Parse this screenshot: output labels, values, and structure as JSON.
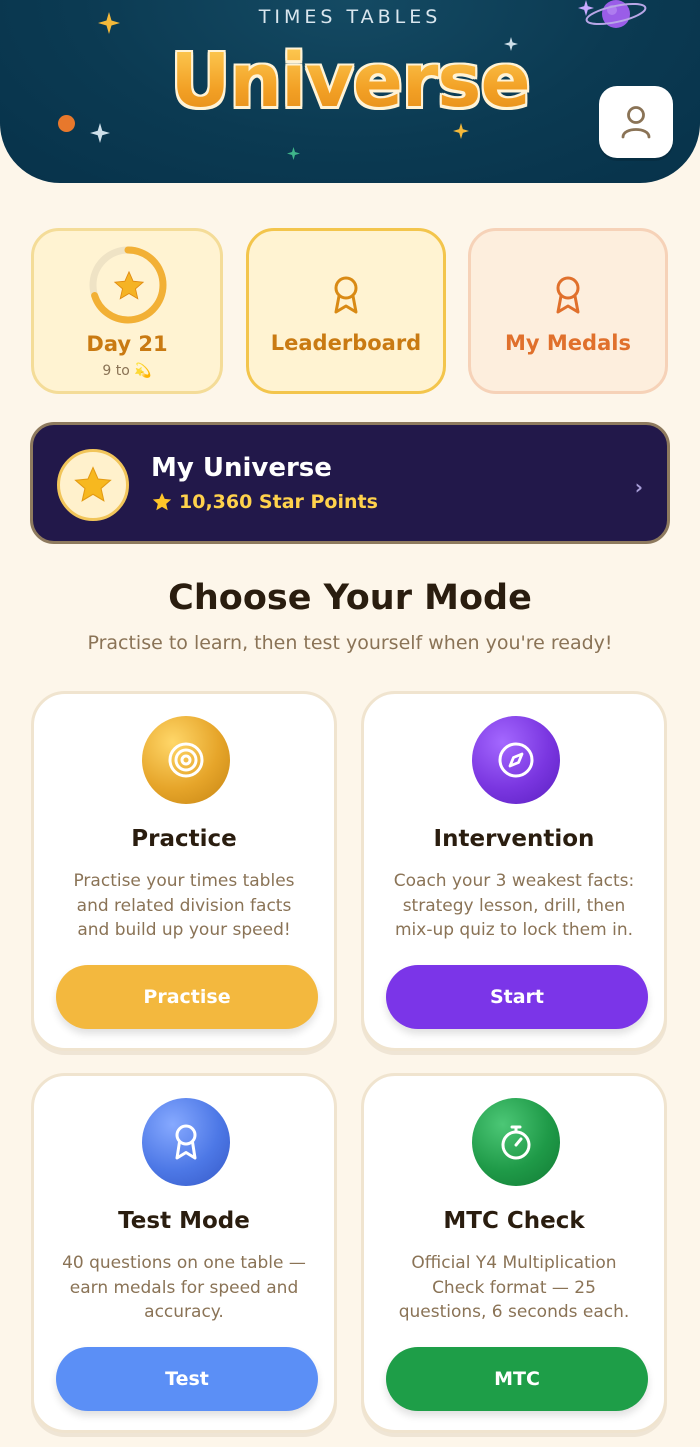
{
  "header": {
    "subtitle": "TIMES TABLES",
    "title": "Universe",
    "profile_icon": "user-icon"
  },
  "stats": {
    "day": {
      "label": "Day 21",
      "sub": "9 to 💫",
      "icon": "star-icon",
      "progress": 0.7
    },
    "leaderboard": {
      "label": "Leaderboard",
      "icon": "ribbon-icon"
    },
    "medals": {
      "label": "My Medals",
      "icon": "ribbon-icon"
    }
  },
  "universe": {
    "title": "My Universe",
    "points": "10,360 Star Points",
    "chevron": "›"
  },
  "modes": {
    "heading": "Choose Your Mode",
    "subheading": "Practise to learn, then test yourself when you're ready!",
    "items": [
      {
        "title": "Practice",
        "desc": "Practise your times tables and related division facts and build up your speed!",
        "button": "Practise",
        "icon": "target-icon",
        "color": "#f3b83e"
      },
      {
        "title": "Intervention",
        "desc": "Coach your 3 weakest facts: strategy lesson, drill, then mix-up quiz to lock them in.",
        "button": "Start",
        "icon": "compass-icon",
        "color": "#7b35e8"
      },
      {
        "title": "Test Mode",
        "desc": "40 questions on one table — earn medals for speed and accuracy.",
        "button": "Test",
        "icon": "ribbon-icon",
        "color": "#5b8ff6"
      },
      {
        "title": "MTC Check",
        "desc": "Official Y4 Multiplication Check format — 25 questions, 6 seconds each.",
        "button": "MTC",
        "icon": "stopwatch-icon",
        "color": "#1e9e48"
      }
    ]
  },
  "colors": {
    "header_bg": "#0b3a52",
    "page_bg": "#fdf6ea",
    "universe_bg": "#22184a",
    "accent_gold": "#f3b83e"
  }
}
